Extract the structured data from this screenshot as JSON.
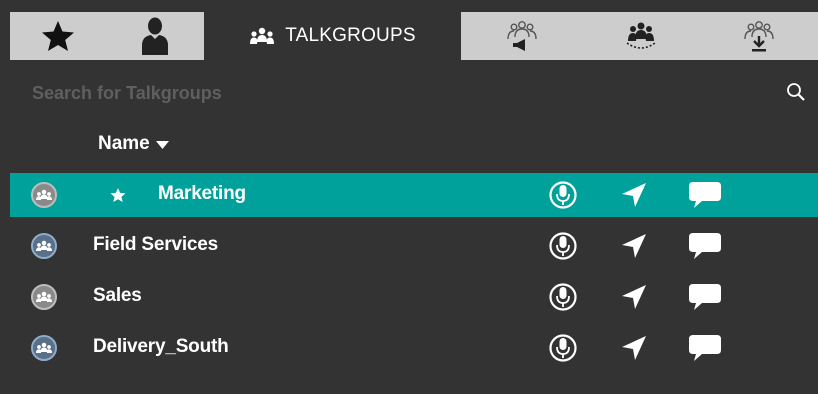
{
  "tabs": [
    {
      "icon": "star-icon",
      "label": ""
    },
    {
      "icon": "person-icon",
      "label": ""
    },
    {
      "icon": "group-icon",
      "label": "TALKGROUPS"
    },
    {
      "icon": "group-broadcast-icon",
      "label": ""
    },
    {
      "icon": "group-dynamic-icon",
      "label": ""
    },
    {
      "icon": "group-download-icon",
      "label": ""
    }
  ],
  "search": {
    "placeholder": "Search for Talkgroups",
    "value": ""
  },
  "list": {
    "column_header": "Name",
    "items": [
      {
        "name": "Marketing",
        "favorite": true,
        "selected": true
      },
      {
        "name": "Field Services",
        "favorite": false,
        "selected": false
      },
      {
        "name": "Sales",
        "favorite": false,
        "selected": false
      },
      {
        "name": "Delivery_South",
        "favorite": false,
        "selected": false
      }
    ]
  },
  "colors": {
    "background": "#333333",
    "selected_row": "#00a19a",
    "tab_inactive": "#cdcdcd",
    "placeholder": "#5f5f5f"
  }
}
